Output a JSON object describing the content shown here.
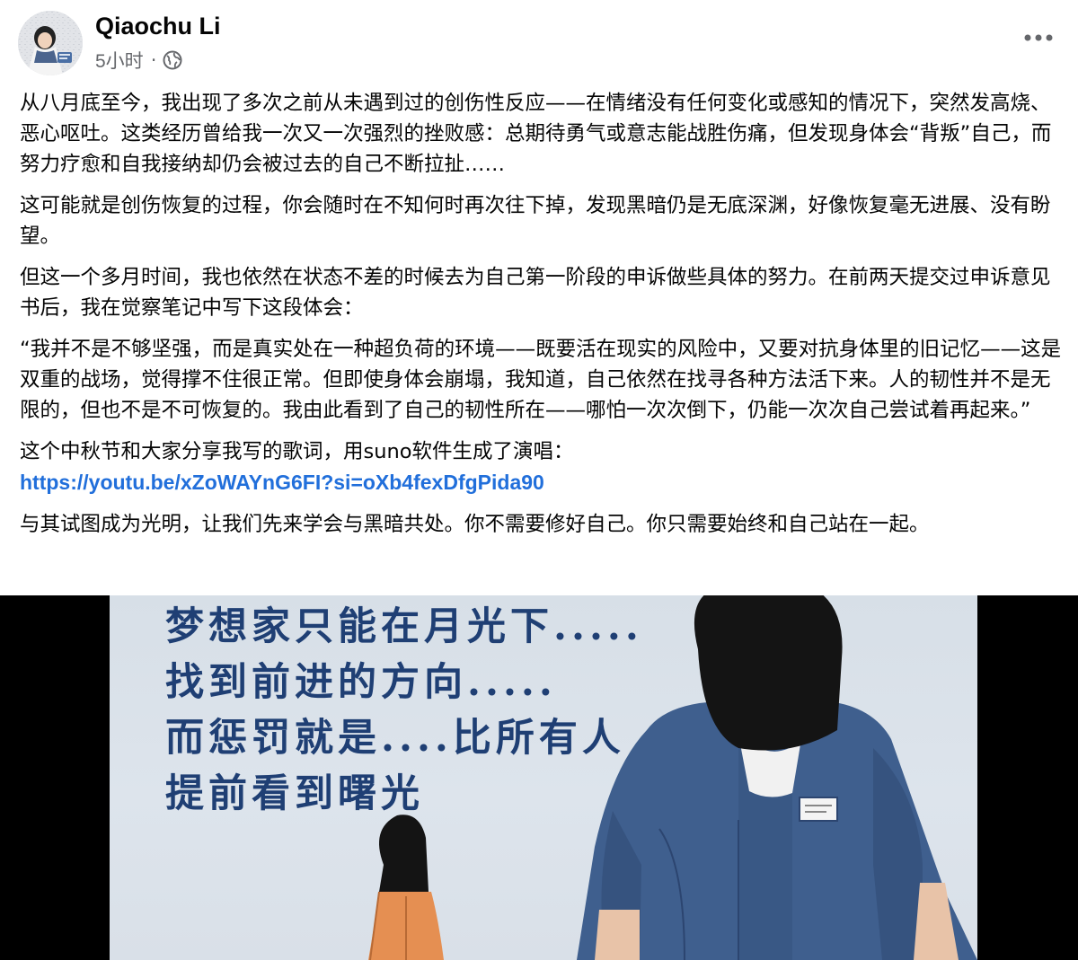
{
  "post": {
    "author_name": "Qiaochu Li",
    "timestamp": "5小时",
    "meta_separator": "·",
    "privacy_icon": "globe-icon",
    "menu_icon": "more-dots-icon",
    "paragraphs": [
      "从八月底至今，我出现了多次之前从未遇到过的创伤性反应——在情绪没有任何变化或感知的情况下，突然发高烧、恶心呕吐。这类经历曾给我一次又一次强烈的挫败感：总期待勇气或意志能战胜伤痛，但发现身体会“背叛”自己，而努力疗愈和自我接纳却仍会被过去的自己不断拉扯……",
      "这可能就是创伤恢复的过程，你会随时在不知何时再次往下掉，发现黑暗仍是无底深渊，好像恢复毫无进展、没有盼望。",
      "但这一个多月时间，我也依然在状态不差的时候去为自己第一阶段的申诉做些具体的努力。在前两天提交过申诉意见书后，我在觉察笔记中写下这段体会：",
      "“我并不是不够坚强，而是真实处在一种超负荷的环境——既要活在现实的风险中，又要对抗身体里的旧记忆——这是双重的战场，觉得撑不住很正常。但即使身体会崩塌，我知道，自己依然在找寻各种方法活下来。人的韧性并不是无限的，但也不是不可恢复的。我由此看到了自己的韧性所在——哪怕一次次倒下，仍能一次次自己尝试着再起来。”"
    ],
    "song_intro": "这个中秋节和大家分享我写的歌词，用suno软件生成了演唱：",
    "song_link": "https://youtu.be/xZoWAYnG6FI?si=oXb4fexDfgPida90",
    "closing": "与其试图成为光明，让我们先来学会与黑暗共处。你不需要修好自己。你只需要始终和自己站在一起。"
  },
  "attachment": {
    "lyric_lines": [
      "梦想家只能在月光下.....",
      "找到前进的方向.....",
      "而惩罚就是....比所有人",
      "提前看到曙光"
    ],
    "colors": {
      "background": "#dbe2ea",
      "lyric_text": "#1f3f74",
      "prison_uniform": "#3f5f8e",
      "hood": "#141414",
      "girl_jacket": "#e58f52",
      "skin": "#e8c3a8"
    }
  }
}
